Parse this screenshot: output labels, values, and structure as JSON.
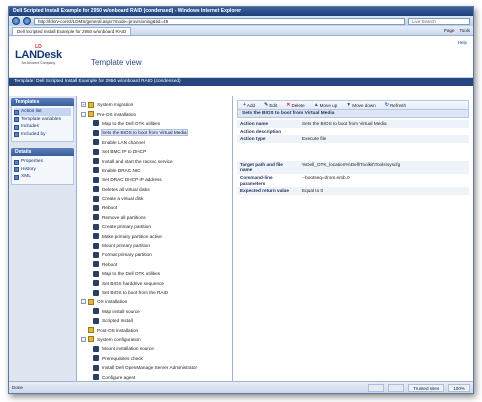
{
  "window_title": "Dell Scripted Install Example for 2950 w/onboard RAID (condensed) - Windows Internet Explorer",
  "address": "http://ldsrv-core2/LDMS/general.aspx?mode=provisioning&tid=49",
  "search_placeholder": "Live Search",
  "tab_label": "Dell Scripted Install Example for 2950 w/onboard RAID",
  "tab_tools": [
    "Page",
    "Tools"
  ],
  "logo": {
    "mark": "LD",
    "name": "LANDesk",
    "sub": "An Avocent Company"
  },
  "page_title": "Template view",
  "help": "Help",
  "template_bar": "Template: Dell Scripted Install Example for 2950 w/onboard RAID (condensed)",
  "left_panels": [
    {
      "title": "Templates",
      "items": [
        {
          "label": "Action list",
          "selected": true
        },
        {
          "label": "Template variables",
          "selected": false
        },
        {
          "label": "Includes",
          "selected": false
        },
        {
          "label": "Included by",
          "selected": false
        }
      ]
    },
    {
      "title": "Details",
      "items": [
        {
          "label": "Properties",
          "selected": false
        },
        {
          "label": "History",
          "selected": false
        },
        {
          "label": "XML",
          "selected": false
        }
      ]
    }
  ],
  "tree": [
    {
      "label": "System migration",
      "level": 0,
      "group": true,
      "exp": "+"
    },
    {
      "label": "Pre-OS installation",
      "level": 0,
      "group": true,
      "exp": "-"
    },
    {
      "label": "Map to the Dell OTK utilities",
      "level": 1
    },
    {
      "label": "Sets the BIOS to boot from Virtual Media",
      "level": 1,
      "selected": true
    },
    {
      "label": "Enable LAN channel",
      "level": 1
    },
    {
      "label": "Set BMC IP to DHCP",
      "level": 1
    },
    {
      "label": "Install and start the racsvc service",
      "level": 1
    },
    {
      "label": "Enable DRAC NIC",
      "level": 1
    },
    {
      "label": "Set DRAC DHCP IP address",
      "level": 1
    },
    {
      "label": "Deletes all virtual disks",
      "level": 1
    },
    {
      "label": "Create a virtual disk",
      "level": 1
    },
    {
      "label": "Reboot",
      "level": 1
    },
    {
      "label": "Remove all partitions",
      "level": 1
    },
    {
      "label": "Create primary partition",
      "level": 1
    },
    {
      "label": "Make primary partition active",
      "level": 1
    },
    {
      "label": "Mount primary partition",
      "level": 1
    },
    {
      "label": "Format primary partition",
      "level": 1
    },
    {
      "label": "Reboot",
      "level": 1
    },
    {
      "label": "Map to the Dell OTK utilities",
      "level": 1
    },
    {
      "label": "Set BIOS harddrive sequence",
      "level": 1
    },
    {
      "label": "Set BIOS to boot from the RAID",
      "level": 1
    },
    {
      "label": "OS installation",
      "level": 0,
      "group": true,
      "exp": "-"
    },
    {
      "label": "Map install source",
      "level": 1
    },
    {
      "label": "Scripted Install",
      "level": 1
    },
    {
      "label": "Post-OS installation",
      "level": 0,
      "group": true,
      "exp": ""
    },
    {
      "label": "System configuration",
      "level": 0,
      "group": true,
      "exp": "-"
    },
    {
      "label": "Mount installation source",
      "level": 1
    },
    {
      "label": "Prerequisites check",
      "level": 1
    },
    {
      "label": "Install Dell OpenManage Server Administrator",
      "level": 1
    },
    {
      "label": "Configure agent",
      "level": 1
    }
  ],
  "toolbar": [
    {
      "glyph": "+",
      "label": "Add",
      "icon": "add-icon"
    },
    {
      "glyph": "✎",
      "label": "Edit",
      "icon": "edit-icon"
    },
    {
      "glyph": "✕",
      "label": "Delete",
      "icon": "delete-icon"
    },
    {
      "glyph": "▲",
      "label": "Move up",
      "icon": "move-up-icon"
    },
    {
      "glyph": "▼",
      "label": "Move down",
      "icon": "move-down-icon"
    },
    {
      "glyph": "↻",
      "label": "Refresh",
      "icon": "refresh-icon"
    }
  ],
  "detail_title": "Sets the BIOS to boot from Virtual Media",
  "detail_rows": [
    {
      "k": "Action name",
      "v": "Sets the BIOS to boot from Virtual Media"
    },
    {
      "k": "Action description",
      "v": ""
    },
    {
      "k": "Action type",
      "v": "Execute file"
    }
  ],
  "detail_rows2": [
    {
      "k": "Target path and file name",
      "v": "%Dell_OTK_location%\\Dell\\Toolkit\\Tools\\syscfg"
    },
    {
      "k": "Command-line parameters",
      "v": "--bootseq=drom.emb.0"
    },
    {
      "k": "Expected return value",
      "v": "Equal to 0"
    }
  ],
  "status": {
    "left": "Done",
    "zone": "Trusted sites",
    "zoom": "100%"
  }
}
